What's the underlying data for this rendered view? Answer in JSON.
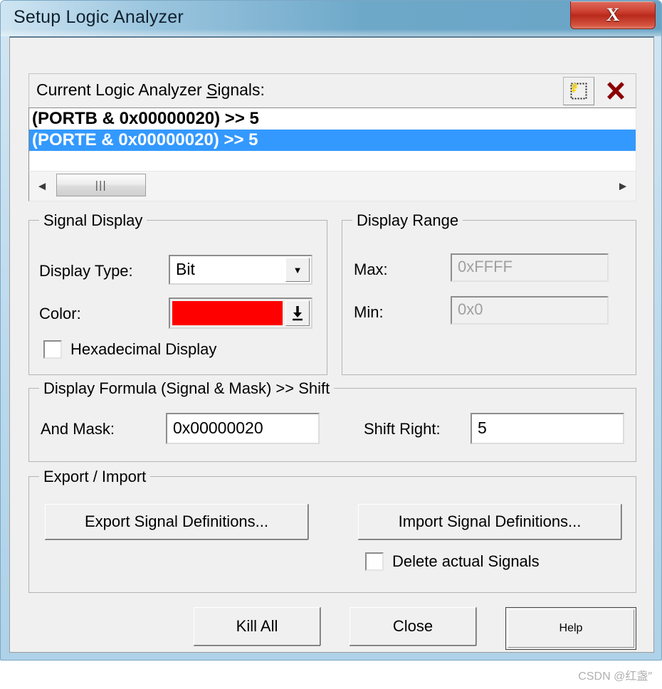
{
  "window": {
    "title": "Setup Logic Analyzer",
    "close_glyph": "X",
    "accent_titlebar": "#6ea8c9",
    "close_button_color": "#c33e2c"
  },
  "signals": {
    "label_prefix": "Current Logic Analyzer ",
    "label_accel": "S",
    "label_suffix": "ignals:",
    "new_button_icon": "new-signal-icon",
    "delete_button_icon": "delete-signal-icon",
    "items": [
      {
        "text": "(PORTB & 0x00000020) >> 5",
        "selected": false
      },
      {
        "text": "(PORTE & 0x00000020) >> 5",
        "selected": true
      }
    ],
    "selection_color": "#3399ff",
    "scrollbar": {
      "left_arrow": "◄",
      "right_arrow": "►",
      "thumb_grip": "|||"
    }
  },
  "signal_display": {
    "title": "Signal Display",
    "display_type_label": "Display Type:",
    "display_type_value": "Bit",
    "display_type_options": [
      "Bit"
    ],
    "color_label": "Color:",
    "color_value": "#ff0000",
    "hexadecimal_label": "Hexadecimal Display",
    "hexadecimal_checked": false
  },
  "display_range": {
    "title": "Display Range",
    "max_label": "Max:",
    "max_value": "0xFFFF",
    "min_label": "Min:",
    "min_value": "0x0",
    "disabled": true
  },
  "display_formula": {
    "title": "Display Formula (Signal & Mask) >> Shift",
    "and_mask_label": "And Mask:",
    "and_mask_value": "0x00000020",
    "shift_right_label": "Shift Right:",
    "shift_right_value": "5"
  },
  "export_import": {
    "title": "Export / Import",
    "export_button": "Export Signal Definitions...",
    "import_button": "Import Signal Definitions...",
    "delete_actual_label": "Delete actual Signals",
    "delete_actual_checked": false
  },
  "bottom_buttons": {
    "kill_all": "Kill All",
    "close": "Close",
    "help": "Help"
  },
  "watermark": "CSDN @红盏″"
}
